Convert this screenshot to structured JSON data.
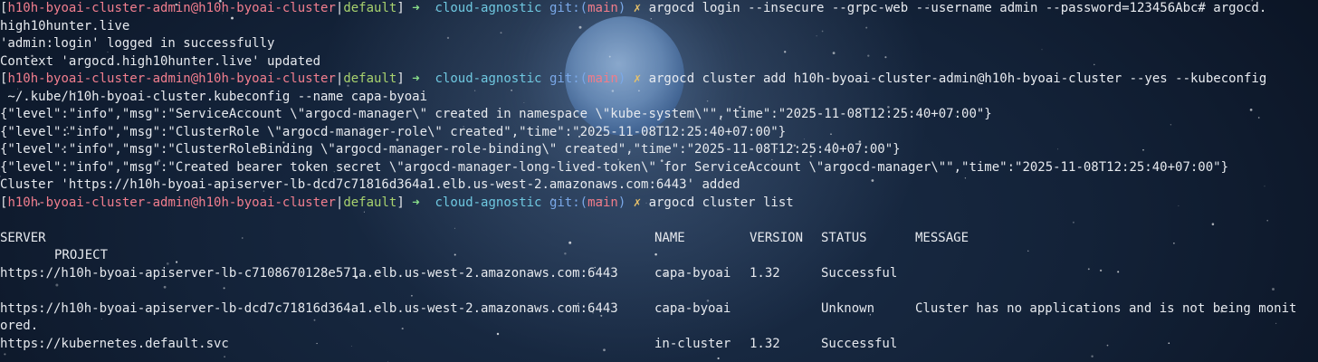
{
  "prompt": {
    "user_host": "h10h-byoai-cluster-admin@h10h-byoai-cluster",
    "context": "default",
    "arrow": "➜",
    "dir": "cloud-agnostic",
    "git_label": "git:(",
    "branch": "main",
    "git_close": ")",
    "dirty_mark": "✗"
  },
  "commands": [
    {
      "text_line1": "argocd login --insecure --grpc-web --username admin --password=123456Abc# argocd.",
      "text_line2": "high10hunter.live"
    },
    {
      "text_line1": "argocd cluster add h10h-byoai-cluster-admin@h10h-byoai-cluster --yes --kubeconfig",
      "text_line2": " ~/.kube/h10h-byoai-cluster.kubeconfig --name capa-byoai"
    },
    {
      "text_line1": "argocd cluster list"
    }
  ],
  "output_login": [
    "'admin:login' logged in successfully",
    "Context 'argocd.high10hunter.live' updated"
  ],
  "output_add": [
    "{\"level\":\"info\",\"msg\":\"ServiceAccount \\\"argocd-manager\\\" created in namespace \\\"kube-system\\\"\",\"time\":\"2025-11-08T12:25:40+07:00\"}",
    "{\"level\":\"info\",\"msg\":\"ClusterRole \\\"argocd-manager-role\\\" created\",\"time\":\"2025-11-08T12:25:40+07:00\"}",
    "{\"level\":\"info\",\"msg\":\"ClusterRoleBinding \\\"argocd-manager-role-binding\\\" created\",\"time\":\"2025-11-08T12:25:40+07:00\"}",
    "{\"level\":\"info\",\"msg\":\"Created bearer token secret \\\"argocd-manager-long-lived-token\\\" for ServiceAccount \\\"argocd-manager\\\"\",\"time\":\"2025-11-08T12:25:40+07:00\"}",
    "Cluster 'https://h10h-byoai-apiserver-lb-dcd7c71816d364a1.elb.us-west-2.amazonaws.com:6443' added"
  ],
  "cluster_table": {
    "headers": {
      "server": "SERVER",
      "name": "NAME",
      "version": "VERSION",
      "status": "STATUS",
      "message": "MESSAGE",
      "project": "PROJECT"
    },
    "rows": [
      {
        "server": "https://h10h-byoai-apiserver-lb-c7108670128e571a.elb.us-west-2.amazonaws.com:6443",
        "name": "capa-byoai",
        "version": "1.32",
        "status": "Successful",
        "message": ""
      },
      {
        "server": "https://h10h-byoai-apiserver-lb-dcd7c71816d364a1.elb.us-west-2.amazonaws.com:6443",
        "name": "capa-byoai",
        "version": "",
        "status": "Unknown",
        "message": "Cluster has no applications and is not being monit",
        "message_wrap": "ored."
      },
      {
        "server": "https://kubernetes.default.svc",
        "name": "in-cluster",
        "version": "1.32",
        "status": "Successful",
        "message": ""
      }
    ]
  }
}
